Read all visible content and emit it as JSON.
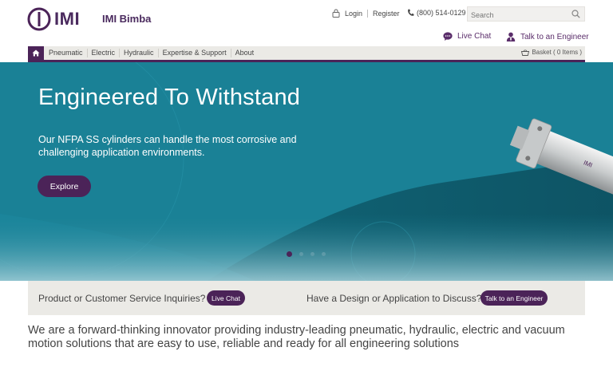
{
  "header": {
    "logo_text": "IMI",
    "brand_name": "IMI Bimba",
    "login": "Login",
    "register": "Register",
    "phone": "(800) 514-0129",
    "search_placeholder": "Search",
    "live_chat": "Live Chat",
    "talk_engineer": "Talk to an Engineer",
    "brand_color": "#4b2358"
  },
  "nav": {
    "home_icon": "home-icon",
    "items": [
      "Pneumatic",
      "Electric",
      "Hydraulic",
      "Expertise & Support",
      "About"
    ],
    "basket": "Basket ( 0 Items )"
  },
  "hero": {
    "title": "Engineered To Withstand",
    "copy": "Our NFPA SS cylinders can handle the most corrosive and challenging application environments.",
    "cta": "Explore",
    "slide_count": 4,
    "active_slide": 1,
    "bg_color": "#1a8196"
  },
  "inquiry": {
    "left_text": "Product or Customer Service Inquiries?",
    "left_button": "Live Chat",
    "right_text": "Have a Design or Application to Discuss?",
    "right_button": "Talk to an Engineer"
  },
  "tagline": "We are a forward-thinking innovator providing industry-leading pneumatic, hydraulic, electric and vacuum motion solutions that are easy to use, reliable and ready for all engineering solutions"
}
